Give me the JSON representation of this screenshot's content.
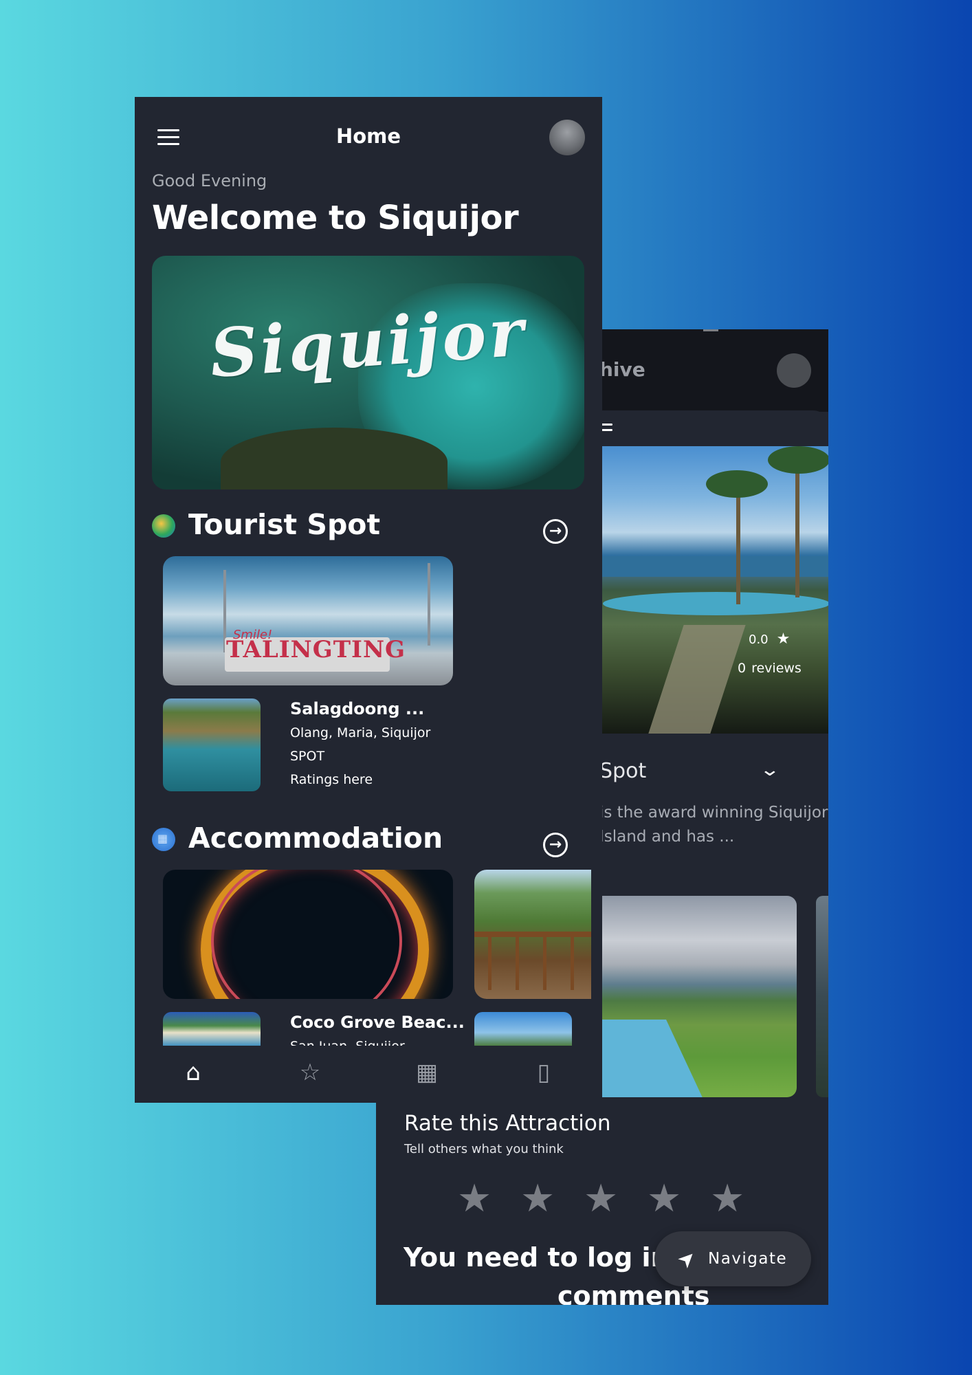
{
  "front": {
    "appbar": {
      "title": "Home"
    },
    "greeting": "Good Evening",
    "welcome": "Welcome to Siquijor",
    "banner_word": "Siquijor",
    "tourist_section": {
      "heading": "Tourist Spot",
      "featured_sign_text": "TALINGTING",
      "featured_sign_script": "Smile!",
      "item": {
        "title": "Salagdoong ...",
        "location": "Olang, Maria, Siquijor",
        "type": "SPOT",
        "rating": "Ratings here"
      }
    },
    "accommodation_section": {
      "heading": "Accommodation",
      "item": {
        "title": "Coco Grove Beac...",
        "location": "San Juan, Siquijor"
      }
    },
    "bottom_nav": {
      "items": [
        {
          "icon": "home-icon",
          "glyph": "⌂",
          "active": true
        },
        {
          "icon": "star-outline-icon",
          "glyph": "☆",
          "active": false
        },
        {
          "icon": "calendar-icon",
          "glyph": "▦",
          "active": false
        },
        {
          "icon": "book-open-icon",
          "glyph": "▯",
          "active": false
        }
      ]
    }
  },
  "back": {
    "appbar": {
      "title_partial": "hive"
    },
    "hero": {
      "rating": "0.0",
      "review_count": "0",
      "reviews_label": "reviews"
    },
    "section": {
      "heading_partial": "Spot",
      "description_partial": "is the award winning Siquijor Island and has ..."
    },
    "rate": {
      "title": "Rate this Attraction",
      "subtitle": "Tell others what you think",
      "stars": [
        "★",
        "★",
        "★",
        "★",
        "★"
      ]
    },
    "login_message_line1": "You need to log in",
    "login_message_line2": "comments",
    "navigate_label": "Navigate"
  },
  "colors": {
    "panel_bg": "#222631",
    "appbar_dark": "#14161c",
    "star_inactive": "#7a7d84",
    "gradient_start": "#5ad8e0",
    "gradient_end": "#0a45b0"
  }
}
